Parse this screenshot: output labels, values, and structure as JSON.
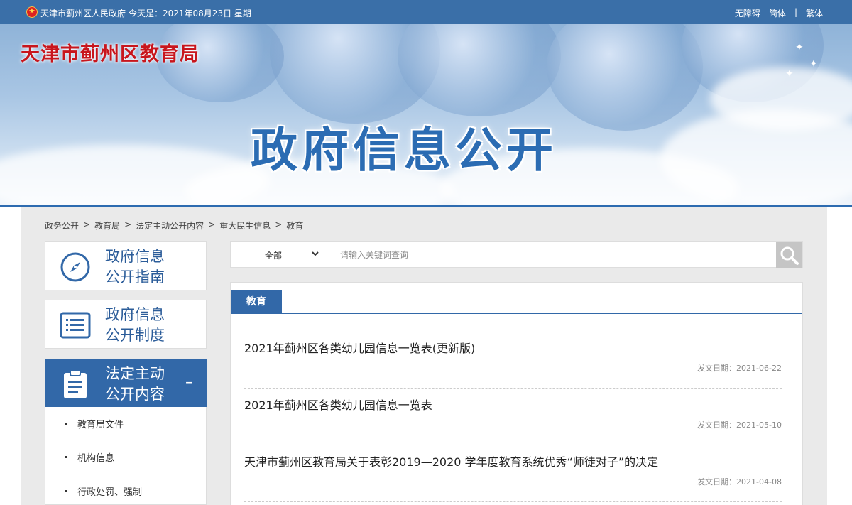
{
  "topbar": {
    "site_name": "天津市蓟州区人民政府",
    "date_label": "今天是：",
    "date_value": "2021年08月23日 星期一",
    "accessibility": "无障碍",
    "simplified": "简体",
    "separator": "|",
    "traditional": "繁体"
  },
  "banner": {
    "bureau_name": "天津市蓟州区教育局",
    "title": "政府信息公开"
  },
  "breadcrumb": [
    "政务公开",
    ">",
    "教育局",
    ">",
    "法定主动公开内容",
    ">",
    "重大民生信息",
    ">",
    "教育"
  ],
  "sidebar": {
    "items": [
      {
        "line1": "政府信息",
        "line2": "公开指南",
        "icon": "compass-icon"
      },
      {
        "line1": "政府信息",
        "line2": "公开制度",
        "icon": "list-icon"
      },
      {
        "line1": "法定主动",
        "line2": "公开内容",
        "icon": "clipboard-icon",
        "toggle": "–"
      }
    ],
    "sub_items": [
      "教育局文件",
      "机构信息",
      "行政处罚、强制"
    ]
  },
  "search": {
    "scope": "全部",
    "placeholder": "请输入关键词查询"
  },
  "panel": {
    "tab": "教育",
    "items": [
      {
        "title": "2021年蓟州区各类幼儿园信息一览表(更新版)",
        "date": "发文日期：2021-06-22"
      },
      {
        "title": "2021年蓟州区各类幼儿园信息一览表",
        "date": "发文日期：2021-05-10"
      },
      {
        "title": "天津市蓟州区教育局关于表彰2019—2020 学年度教育系统优秀“师徒对子”的决定",
        "date": "发文日期：2021-04-08"
      }
    ]
  },
  "colors": {
    "topbar": "#3a6fa8",
    "accent": "#3268a8",
    "bureau_red": "#c8161d",
    "banner_title": "#2b6cb3"
  }
}
